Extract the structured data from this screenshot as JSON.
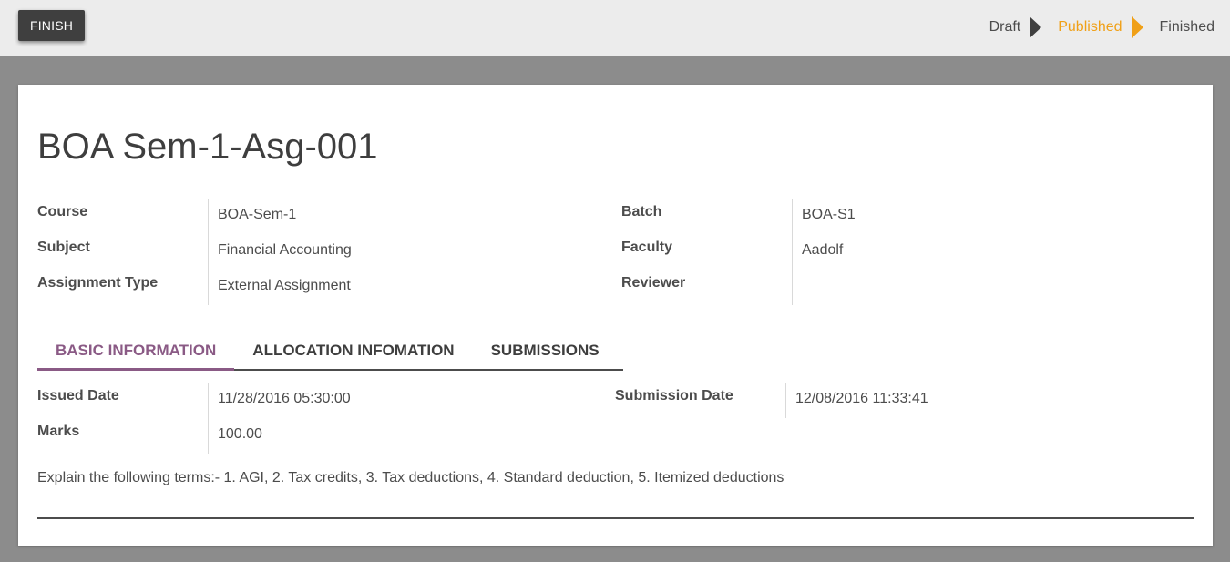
{
  "statusbar": {
    "finish_label": "FINISH",
    "stages": [
      {
        "label": "Draft",
        "active": false
      },
      {
        "label": "Published",
        "active": true
      },
      {
        "label": "Finished",
        "active": false
      }
    ]
  },
  "record": {
    "title": "BOA Sem-1-Asg-001",
    "fields_left": [
      {
        "label": "Course",
        "value": "BOA-Sem-1"
      },
      {
        "label": "Subject",
        "value": "Financial Accounting"
      },
      {
        "label": "Assignment Type",
        "value": "External Assignment"
      }
    ],
    "fields_right": [
      {
        "label": "Batch",
        "value": "BOA-S1"
      },
      {
        "label": "Faculty",
        "value": "Aadolf"
      },
      {
        "label": "Reviewer",
        "value": ""
      }
    ]
  },
  "tabs": [
    {
      "label": "BASIC INFORMATION",
      "active": true
    },
    {
      "label": "ALLOCATION INFOMATION",
      "active": false
    },
    {
      "label": "SUBMISSIONS",
      "active": false
    }
  ],
  "basic_info": {
    "issued_date_label": "Issued Date",
    "issued_date_value": "11/28/2016 05:30:00",
    "marks_label": "Marks",
    "marks_value": "100.00",
    "submission_date_label": "Submission Date",
    "submission_date_value": "12/08/2016 11:33:41",
    "description": "Explain the following terms:- 1. AGI, 2. Tax credits, 3. Tax deductions, 4. Standard deduction, 5. Itemized deductions"
  },
  "colors": {
    "accent_stage": "#f0a017",
    "accent_tab": "#8a5a85",
    "button_bg": "#3f3f3f"
  }
}
